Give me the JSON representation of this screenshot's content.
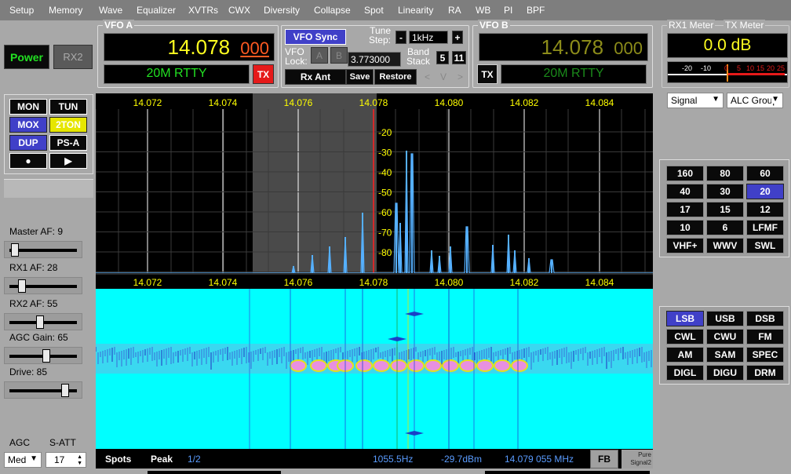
{
  "menu": [
    "Setup",
    "Memory",
    "Wave",
    "Equalizer",
    "XVTRs",
    "CWX",
    "Diversity",
    "Collapse",
    "Spot",
    "Linearity",
    "RA",
    "WB",
    "PI",
    "BPF"
  ],
  "power": {
    "power_label": "Power",
    "rx2_label": "RX2"
  },
  "vfo_a": {
    "title": "VFO A",
    "freq_main": "14.078",
    "freq_sub": "000",
    "mode_band": "20M RTTY",
    "tx_label": "TX"
  },
  "vfo_b": {
    "title": "VFO B",
    "freq_main": "14.078",
    "freq_sub": "000",
    "mode_band": "20M RTTY",
    "tx_label": "TX"
  },
  "vfo_center": {
    "sync_label": "VFO Sync",
    "tune_step_label": "Tune\nStep:",
    "tune_minus": "-",
    "tune_value": "1kHz",
    "tune_plus": "+",
    "vfo_lock_label": "VFO\nLock:",
    "lock_a": "A",
    "lock_b": "B",
    "lock_value": "3.773000",
    "band_stack_label": "Band\nStack",
    "band_stack_a": "5",
    "band_stack_b": "11",
    "rx_ant_label": "Rx Ant",
    "save_label": "Save",
    "restore_label": "Restore",
    "nav_back": "<",
    "nav_down": "V",
    "nav_fwd": ">"
  },
  "meters": {
    "rx1_title": "RX1 Meter",
    "tx_title": "TX Meter",
    "reading": "0.0 dB",
    "scale": [
      "-20",
      "-10",
      "0",
      "5",
      "10",
      "15",
      "20",
      "25"
    ],
    "rx_select": "Signal",
    "tx_select": "ALC Group"
  },
  "func_buttons": [
    {
      "label": "MON",
      "style": "dark"
    },
    {
      "label": "TUN",
      "style": "dark"
    },
    {
      "label": "MOX",
      "style": "blue"
    },
    {
      "label": "2TON",
      "style": "yel"
    },
    {
      "label": "DUP",
      "style": "blue"
    },
    {
      "label": "PS-A",
      "style": "dark"
    },
    {
      "label": "●",
      "style": "dark"
    },
    {
      "label": "▶",
      "style": "dark"
    }
  ],
  "sliders": [
    {
      "label": "Master AF:",
      "value": "9",
      "level": 0.05
    },
    {
      "label": "RX1 AF:",
      "value": "28",
      "level": 0.16
    },
    {
      "label": "RX2 AF:",
      "value": "55",
      "level": 0.45
    },
    {
      "label": "AGC Gain:",
      "value": "65",
      "level": 0.55
    },
    {
      "label": "Drive:",
      "value": "85",
      "level": 0.85
    }
  ],
  "agc": {
    "agc_label": "AGC",
    "satt_label": "S-ATT",
    "agc_value": "Med",
    "satt_value": "17"
  },
  "bands": [
    {
      "label": "160",
      "active": false
    },
    {
      "label": "80",
      "active": false
    },
    {
      "label": "60",
      "active": false
    },
    {
      "label": "40",
      "active": false
    },
    {
      "label": "30",
      "active": false
    },
    {
      "label": "20",
      "active": true
    },
    {
      "label": "17",
      "active": false
    },
    {
      "label": "15",
      "active": false
    },
    {
      "label": "12",
      "active": false
    },
    {
      "label": "10",
      "active": false
    },
    {
      "label": "6",
      "active": false
    },
    {
      "label": "LFMF",
      "active": false
    },
    {
      "label": "VHF+",
      "active": false
    },
    {
      "label": "WWV",
      "active": false
    },
    {
      "label": "SWL",
      "active": false
    }
  ],
  "modes": [
    {
      "label": "LSB",
      "active": true
    },
    {
      "label": "USB",
      "active": false
    },
    {
      "label": "DSB",
      "active": false
    },
    {
      "label": "CWL",
      "active": false
    },
    {
      "label": "CWU",
      "active": false
    },
    {
      "label": "FM",
      "active": false
    },
    {
      "label": "AM",
      "active": false
    },
    {
      "label": "SAM",
      "active": false
    },
    {
      "label": "SPEC",
      "active": false
    },
    {
      "label": "DIGL",
      "active": false
    },
    {
      "label": "DIGU",
      "active": false
    },
    {
      "label": "DRM",
      "active": false
    }
  ],
  "spectrum": {
    "freq_ticks": [
      "14.072",
      "14.074",
      "14.076",
      "14.078",
      "14.080",
      "14.082",
      "14.084"
    ],
    "db_ticks": [
      "-20",
      "-30",
      "-40",
      "-50",
      "-60",
      "-70",
      "-80"
    ],
    "colors": {
      "tick_text": "#ffff00",
      "trace": "#55b0ff",
      "grid": "#3a3a3a",
      "marker": "#ff2020",
      "waterfall_bg": "#00ffff"
    }
  },
  "status": {
    "spots": "Spots",
    "peak": "Peak",
    "page": "1/2",
    "freq_offset": "1055.5Hz",
    "level": "-29.7dBm",
    "cursor_freq": "14.079 055 MHz",
    "fb": "FB",
    "pure_signal": "Pure\nSignal2"
  }
}
